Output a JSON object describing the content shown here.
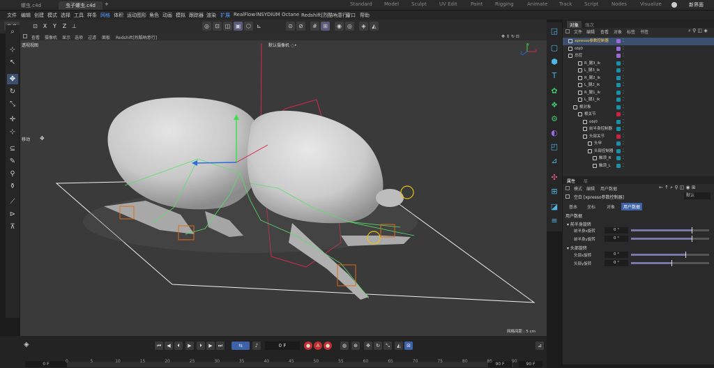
{
  "titlebar": {
    "tabs": [
      "螺虫.c4d",
      "虫子螺虫.c4d"
    ],
    "plus": "+",
    "layouts": [
      "Standard",
      "Model",
      "Sculpt",
      "UV Edit",
      "Paint",
      "Rigging",
      "Animate",
      "Track",
      "Script",
      "Nodes",
      "Visualize"
    ],
    "new_ui": "新界面"
  },
  "menubar": {
    "items": [
      "文件",
      "编辑",
      "创建",
      "模式",
      "选择",
      "工具",
      "样条",
      "网格",
      "体积",
      "运动图形",
      "角色",
      "动画",
      "模拟",
      "跟踪器",
      "渲染",
      "扩展",
      "RealFlow",
      "INSYDIUM",
      "Octane",
      "Redshift[烈酷吶意行]",
      "窗口",
      "帮助"
    ]
  },
  "toolbar": {
    "axes": [
      "X",
      "Y",
      "Z"
    ]
  },
  "viewport": {
    "menu": [
      "查看",
      "摄像机",
      "显示",
      "选项",
      "过滤",
      "面板",
      "Redshift[烈酷吶意行]"
    ],
    "label": "透视视图",
    "camera": "默认摄像机 ◌•",
    "move_label": "移动",
    "grid_label": "网格间距 : 5 cm",
    "axis_y": "Y",
    "axis_x": "X",
    "axis_z": "Z"
  },
  "objects": {
    "tabs": [
      "对象",
      "场次"
    ],
    "menu": [
      "文件",
      "编辑",
      "查看",
      "对象",
      "标签",
      "书签"
    ],
    "rows": [
      {
        "name": "xpresso参数控制器",
        "indent": 0,
        "color": "#9a6ad9",
        "hl": true
      },
      {
        "name": "obj0",
        "indent": 0,
        "color": "#9a6ad9"
      },
      {
        "name": "总控",
        "indent": 0,
        "color": "#9a6ad9"
      },
      {
        "name": "R_腿3_ik",
        "indent": 2,
        "color": "#1e8fa8"
      },
      {
        "name": "L_腿3_ik",
        "indent": 2,
        "color": "#1e8fa8"
      },
      {
        "name": "R_腿2_ik",
        "indent": 2,
        "color": "#1e8fa8"
      },
      {
        "name": "L_腿2_ik",
        "indent": 2,
        "color": "#1e8fa8"
      },
      {
        "name": "R_腿1_ik",
        "indent": 2,
        "color": "#1e8fa8"
      },
      {
        "name": "L_腿1_ik",
        "indent": 2,
        "color": "#1e8fa8"
      },
      {
        "name": "根对象",
        "indent": 1,
        "color": "#1e8fa8"
      },
      {
        "name": "根关节",
        "indent": 2,
        "color": "#cc2244"
      },
      {
        "name": "obj0",
        "indent": 3,
        "color": "#1e8fa8"
      },
      {
        "name": "前半身控制器",
        "indent": 3,
        "color": "#1e8fa8"
      },
      {
        "name": "头部关节",
        "indent": 3,
        "color": "#cc2244"
      },
      {
        "name": "头甲",
        "indent": 4,
        "color": "#1e8fa8"
      },
      {
        "name": "头部控制器",
        "indent": 4,
        "color": "#1e8fa8"
      },
      {
        "name": "触须_R",
        "indent": 5,
        "color": "#1e8fa8"
      },
      {
        "name": "触须_L",
        "indent": 5,
        "color": "#1e8fa8"
      }
    ]
  },
  "attributes": {
    "title": "属性",
    "subtitle": "层",
    "menu": [
      "模式",
      "编辑",
      "用户数据"
    ],
    "object_name": "空白 [xpresso参数控制器]",
    "preset": "默认",
    "tabs": [
      "基本",
      "坐标",
      "对象",
      "用户数据"
    ],
    "section": "用户数据",
    "group1": "▾ 前半身旋转",
    "fields1": [
      {
        "label": "前半身x旋转",
        "value": "0 °",
        "slider": 0.78
      },
      {
        "label": "前半身y旋转",
        "value": "0 °",
        "slider": 0.78
      }
    ],
    "group2": "▾ 头部旋转",
    "fields2": [
      {
        "label": "头部x旋转",
        "value": "0 °",
        "slider": 0.7
      },
      {
        "label": "头部y旋转",
        "value": "0 °",
        "slider": 0.52
      }
    ]
  },
  "timeline": {
    "frame_field": "0 F",
    "start_field": "0 F",
    "end_field": "90 F",
    "end_field2": "90 F",
    "ticks": [
      "0",
      "5",
      "10",
      "15",
      "20",
      "25",
      "30",
      "35",
      "40",
      "45",
      "50",
      "55",
      "60",
      "65",
      "70",
      "75",
      "80",
      "85",
      "90"
    ]
  },
  "colors": {
    "accent": "#4f9dff",
    "selection": "#3c4f6e",
    "user_data_tab": "#3d62a8"
  }
}
